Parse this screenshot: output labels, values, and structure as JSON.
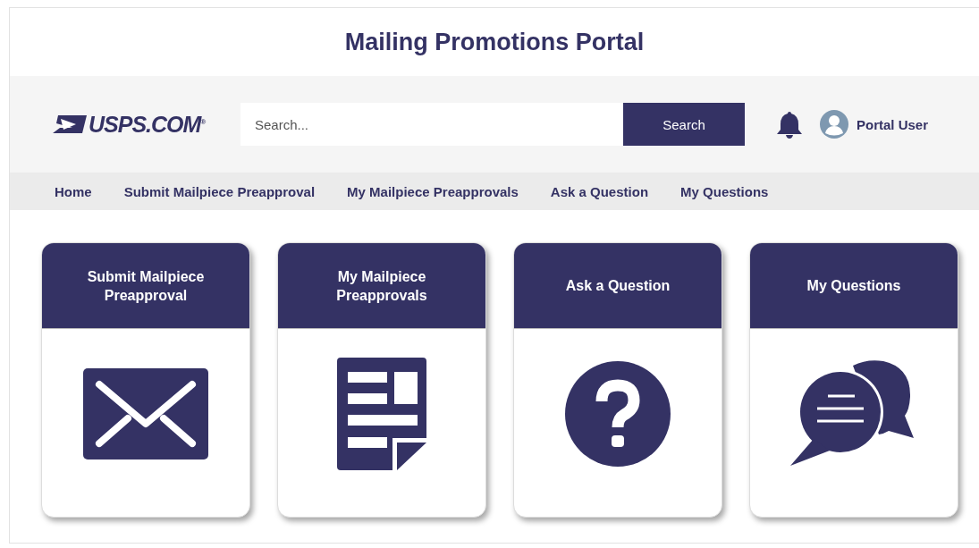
{
  "title": "Mailing Promotions Portal",
  "header": {
    "logo": "USPS.COM$^{®}$",
    "search": {
      "placeholder": "Search..."
    },
    "search_button": "Search",
    "user": "Portal User"
  },
  "nav": [
    {
      "label": "Home"
    },
    {
      "label": "Submit Mailpiece Preapproval"
    },
    {
      "label": "My Mailpiece Preapprovals"
    },
    {
      "label": "Ask a Question"
    },
    {
      "label": "My Questions"
    }
  ],
  "cards": [
    {
      "title": "Submit Mailpiece Preapproval",
      "kind": "envelope"
    },
    {
      "title": "My Mailpiece Preapprovals",
      "kind": "document"
    },
    {
      "title": "Ask a Question",
      "kind": "question"
    },
    {
      "title": "My Questions",
      "kind": "chat"
    }
  ]
}
